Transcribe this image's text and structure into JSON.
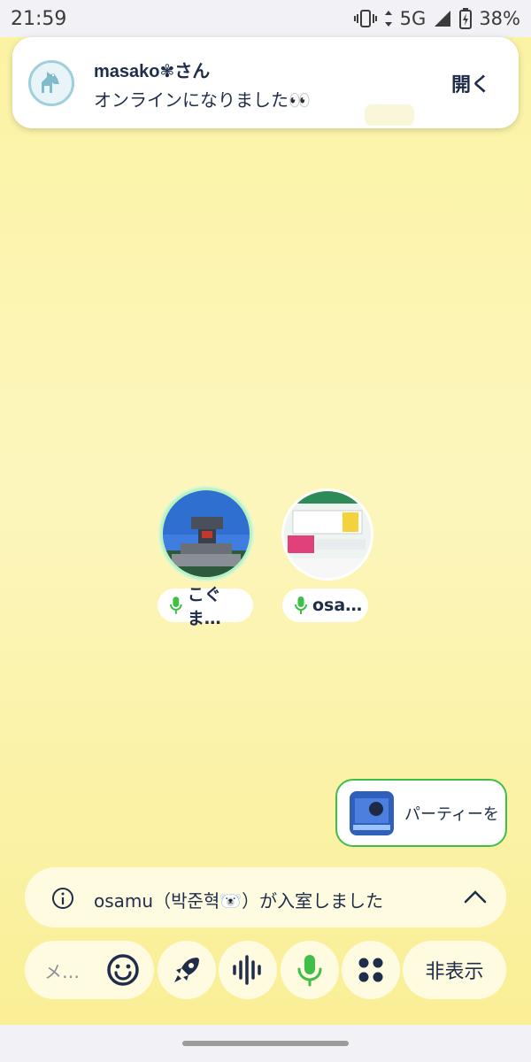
{
  "status_bar": {
    "time": "21:59",
    "network": "5G",
    "battery": "38%"
  },
  "notification": {
    "title": "masako✾さん",
    "body": "オンラインになりました👀",
    "action": "開く"
  },
  "participants": [
    {
      "name": "こぐま…"
    },
    {
      "name": "osa…"
    }
  ],
  "party_card": {
    "label": "パーティーを"
  },
  "system_message": {
    "text": "osamu（박준혁🐻‍❄️）が入室しました"
  },
  "toolbar": {
    "message_placeholder": "メ…",
    "hide_label": "非表示"
  },
  "colors": {
    "accent_green": "#3fbf47",
    "text_navy": "#1f2d4a",
    "background_yellow": "#fbf3a3"
  }
}
